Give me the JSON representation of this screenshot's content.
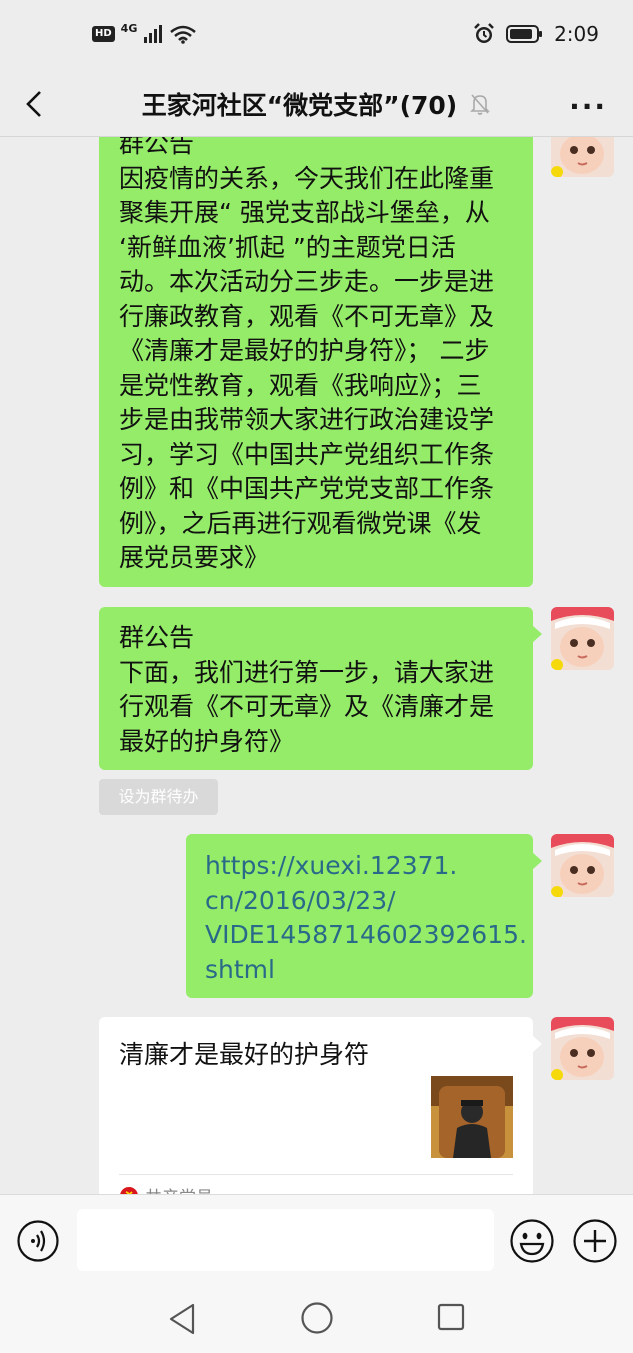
{
  "status": {
    "hd": "HD",
    "network": "4G",
    "time": "2:09"
  },
  "header": {
    "title": "王家河社区“微党支部”(70)",
    "more": "···"
  },
  "messages": {
    "m1": {
      "text": "群公告\n因疫情的关系，今天我们在此隆重\n聚集开展“ 强党支部战斗堡垒，从\n‘新鲜血液’抓起 ”的主题党日活\n动。本次活动分三步走。一步是进\n行廉政教育，观看《不可无章》及\n《清廉才是最好的护身符》； 二步\n是党性教育，观看《我响应》；三\n步是由我带领大家进行政治建设学\n习，学习《中国共产党组织工作条\n例》和《中国共产党党支部工作条\n例》，之后再进行观看微党课《发\n展党员要求》"
    },
    "m2": {
      "text": "群公告\n下面，我们进行第一步，请大家进\n行观看《不可无章》及《清廉才是\n最好的护身符》"
    },
    "todo_button": "设为群待办",
    "m3": {
      "text": "https://xuexi.12371.\ncn/2016/03/23/\nVIDE1458714602392615.\nshtml"
    },
    "m4": {
      "title": "清廉才是最好的护身符",
      "source": "共产党员"
    }
  },
  "icons": {
    "back": "chevron-left-icon",
    "mute": "bell-off-icon",
    "voice": "voice-icon",
    "emoji": "smile-icon",
    "plus": "plus-circle-icon"
  },
  "colors": {
    "bubble_green": "#95ec69",
    "link": "#2a6a89",
    "background": "#ededed"
  }
}
